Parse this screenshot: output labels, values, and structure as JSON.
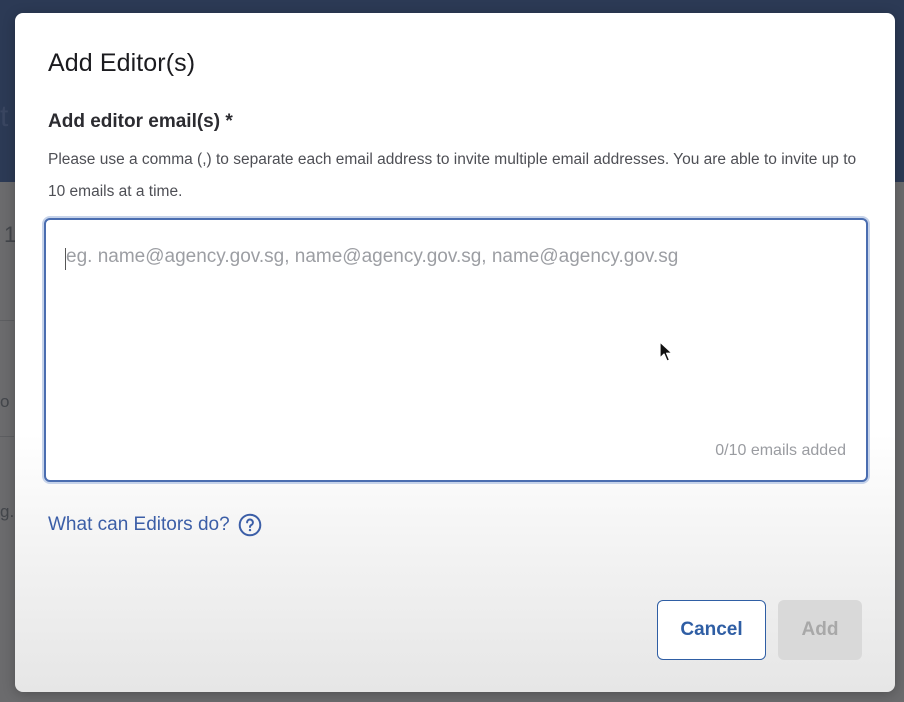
{
  "background": {
    "fragments": [
      "t",
      "1",
      "o",
      "g."
    ]
  },
  "modal": {
    "title": "Add Editor(s)",
    "field_label": "Add editor email(s) *",
    "help_text": "Please use a comma (,) to separate each email address to invite multiple email addresses. You are able to invite up to 10 emails at a time.",
    "input": {
      "value": "",
      "placeholder": "eg. name@agency.gov.sg, name@agency.gov.sg, name@agency.gov.sg",
      "counter": "0/10 emails added"
    },
    "help_link": {
      "label": "What can Editors do?",
      "icon": "question-circle-icon"
    },
    "buttons": {
      "cancel": "Cancel",
      "add": "Add"
    }
  },
  "colors": {
    "accent": "#2f5ea4",
    "focus_border": "#4a6db0",
    "disabled_bg": "#d9d9d9",
    "disabled_text": "#a8a8a8",
    "header_bg": "#2c3a55"
  }
}
